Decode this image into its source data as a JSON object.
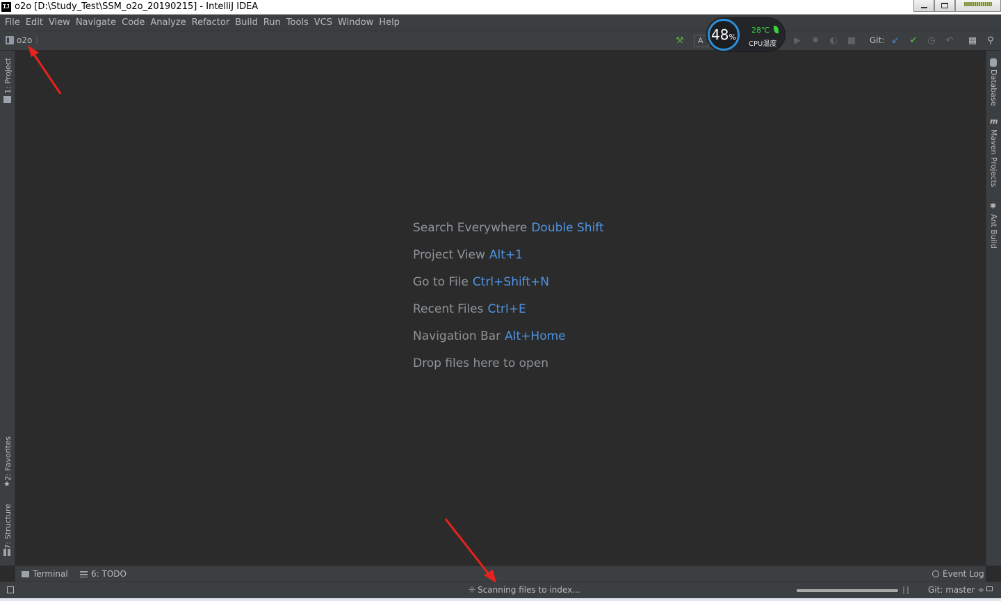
{
  "window": {
    "title": "o2o [D:\\Study_Test\\SSM_o2o_20190215] - IntelliJ IDEA",
    "app_icon": "IJ"
  },
  "menu": [
    "File",
    "Edit",
    "View",
    "Navigate",
    "Code",
    "Analyze",
    "Refactor",
    "Build",
    "Run",
    "Tools",
    "VCS",
    "Window",
    "Help"
  ],
  "navbar": {
    "breadcrumb": "o2o",
    "run_config_initial": "A",
    "git_label": "Git:"
  },
  "cpu_widget": {
    "usage": "48",
    "usage_unit": "%",
    "temperature": "28℃",
    "label": "CPU温度"
  },
  "left_tool_windows": {
    "project": "1: Project",
    "favorites": "2: Favorites",
    "structure": "7: Structure"
  },
  "right_tool_windows": {
    "database": "Database",
    "maven": "Maven Projects",
    "ant": "Ant Build"
  },
  "editor_hints": [
    {
      "label": "Search Everywhere",
      "key": "Double Shift"
    },
    {
      "label": "Project View",
      "key": "Alt+1"
    },
    {
      "label": "Go to File",
      "key": "Ctrl+Shift+N"
    },
    {
      "label": "Recent Files",
      "key": "Ctrl+E"
    },
    {
      "label": "Navigation Bar",
      "key": "Alt+Home"
    },
    {
      "label": "Drop files here to open",
      "key": ""
    }
  ],
  "bottom_tabs": {
    "terminal": "Terminal",
    "todo": "6: TODO",
    "event_log": "Event Log"
  },
  "status": {
    "message": "Scanning files to index...",
    "progress": 1.0,
    "git_branch": "Git: master ÷"
  },
  "colors": {
    "background": "#2b2b2b",
    "chrome": "#3c3f41",
    "hint_key": "#4e94e3",
    "hint_label": "#8f9499",
    "annotation_arrow": "#e8221c",
    "cpu_ring": "#2d8fd8",
    "cpu_temp": "#3ccf3c"
  }
}
